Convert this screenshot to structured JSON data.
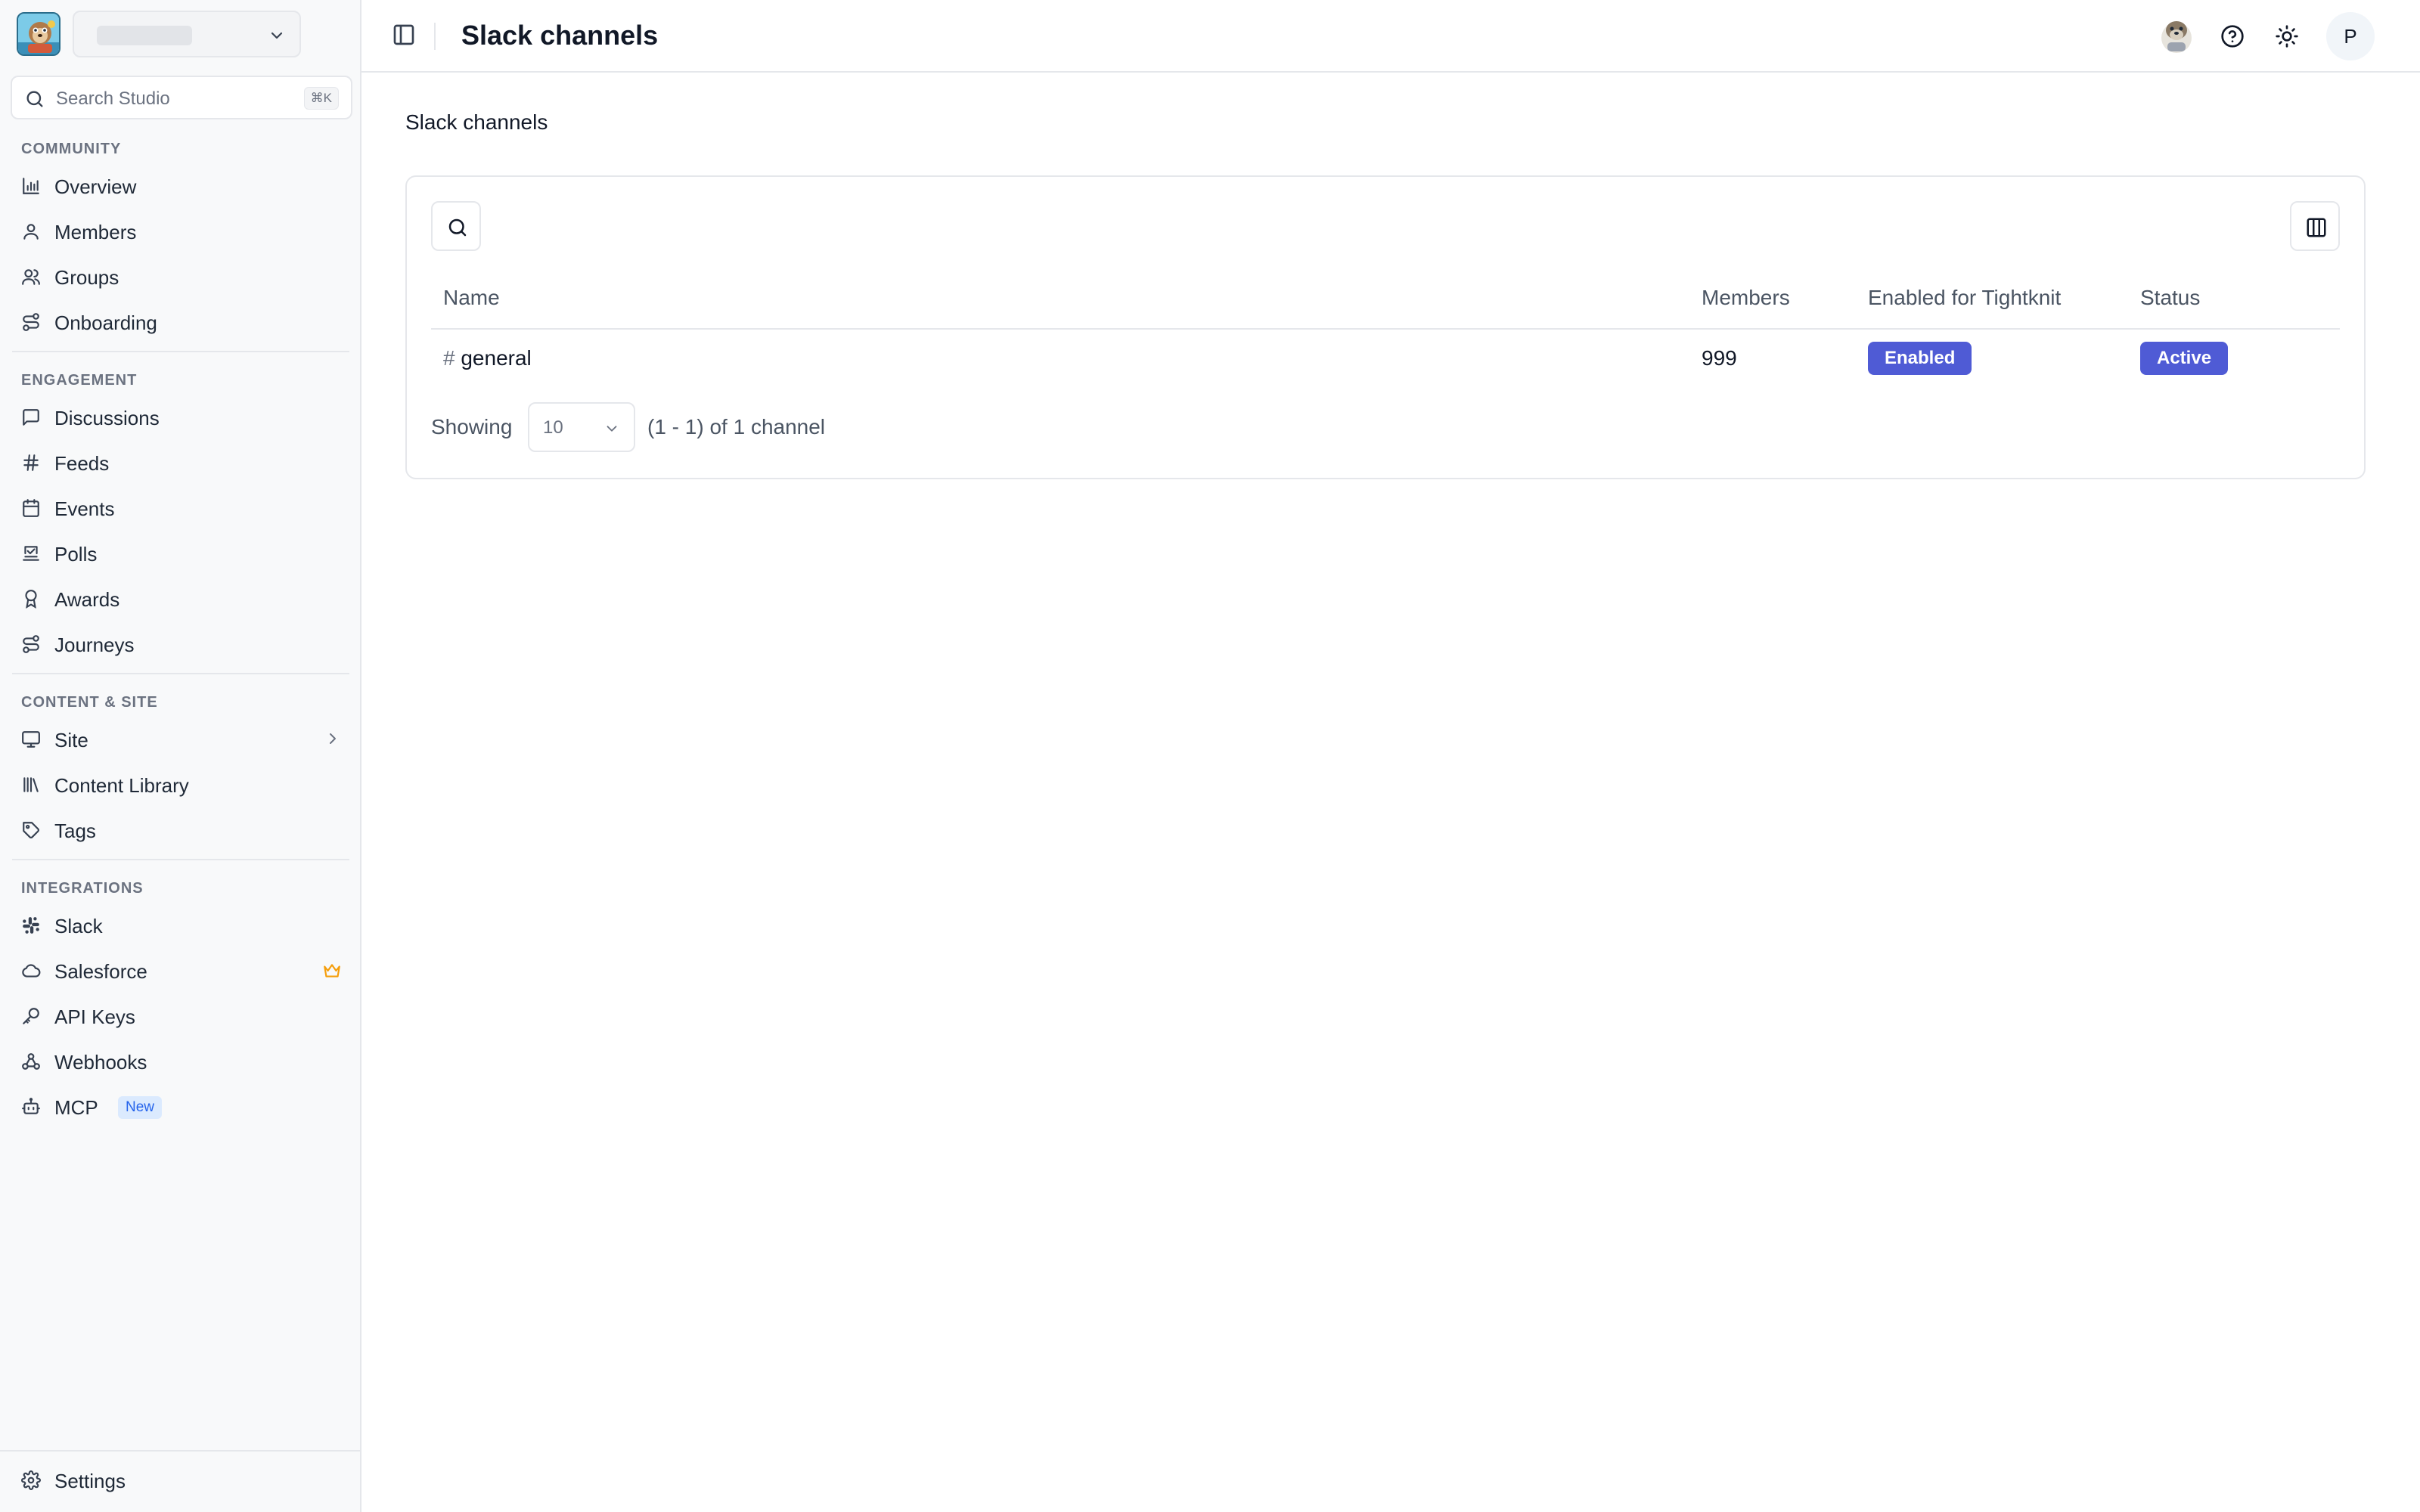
{
  "sidebar": {
    "search": {
      "label": "Search Studio",
      "shortcut": "⌘K"
    },
    "sections": {
      "community": {
        "label": "COMMUNITY",
        "items": [
          {
            "label": "Overview",
            "icon": "bar-chart-icon"
          },
          {
            "label": "Members",
            "icon": "user-icon"
          },
          {
            "label": "Groups",
            "icon": "users-icon"
          },
          {
            "label": "Onboarding",
            "icon": "route-icon"
          }
        ]
      },
      "engagement": {
        "label": "ENGAGEMENT",
        "items": [
          {
            "label": "Discussions",
            "icon": "message-square-icon"
          },
          {
            "label": "Feeds",
            "icon": "hash-icon"
          },
          {
            "label": "Events",
            "icon": "calendar-icon"
          },
          {
            "label": "Polls",
            "icon": "poll-icon"
          },
          {
            "label": "Awards",
            "icon": "award-icon"
          },
          {
            "label": "Journeys",
            "icon": "route-icon"
          }
        ]
      },
      "content": {
        "label": "CONTENT & SITE",
        "items": [
          {
            "label": "Site",
            "icon": "monitor-icon"
          },
          {
            "label": "Content Library",
            "icon": "library-icon"
          },
          {
            "label": "Tags",
            "icon": "tag-icon"
          }
        ]
      },
      "integrations": {
        "label": "INTEGRATIONS",
        "items": [
          {
            "label": "Slack",
            "icon": "slack-icon"
          },
          {
            "label": "Salesforce",
            "icon": "cloud-icon"
          },
          {
            "label": "API Keys",
            "icon": "key-icon"
          },
          {
            "label": "Webhooks",
            "icon": "webhook-icon"
          },
          {
            "label": "MCP",
            "icon": "bot-icon",
            "badge": "New"
          }
        ]
      }
    },
    "settings": {
      "label": "Settings",
      "icon": "gear-icon"
    }
  },
  "topbar": {
    "title": "Slack channels",
    "avatar_initial": "P"
  },
  "main": {
    "section_title": "Slack channels",
    "table": {
      "columns": [
        "Name",
        "Members",
        "Enabled for Tightknit",
        "Status"
      ],
      "rows": [
        {
          "hash": "#",
          "name": "general",
          "members": "999",
          "enabled": "Enabled",
          "status": "Active"
        }
      ]
    },
    "pagination": {
      "label": "Showing",
      "page_size": "10",
      "range": "(1 - 1) of 1 channel"
    }
  },
  "colors": {
    "accent": "#4f5bd5",
    "crown": "#f59e0b",
    "badge_new_bg": "#dbeafe",
    "badge_new_text": "#2563eb"
  }
}
